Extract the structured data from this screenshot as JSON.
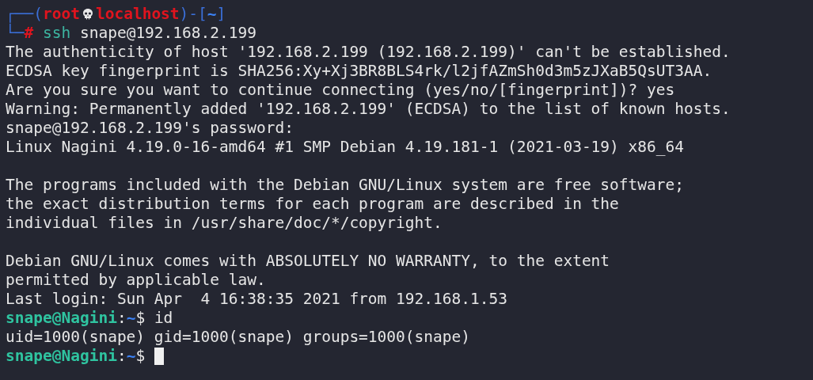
{
  "terminal": {
    "lines": [
      {
        "kind": "prompt",
        "segments": [
          {
            "kind": "frame",
            "text": "┌──("
          },
          {
            "kind": "user",
            "text": "root"
          },
          {
            "kind": "skull"
          },
          {
            "kind": "user",
            "text": "localhost"
          },
          {
            "kind": "frame",
            "text": ")-["
          },
          {
            "kind": "path",
            "text": "~"
          },
          {
            "kind": "frame",
            "text": "]"
          }
        ]
      },
      {
        "kind": "prompt",
        "segments": [
          {
            "kind": "frame",
            "text": "└─"
          },
          {
            "kind": "user",
            "text": "#"
          },
          {
            "kind": "command",
            "text": "ssh",
            "space_before": true
          },
          {
            "kind": "plain",
            "text": "snape@192.168.2.199",
            "space_before": true
          }
        ]
      },
      {
        "kind": "output",
        "text": "The authenticity of host '192.168.2.199 (192.168.2.199)' can't be established."
      },
      {
        "kind": "output",
        "text": "ECDSA key fingerprint is SHA256:Xy+Xj3BR8BLS4rk/l2jfAZmSh0d3m5zJXaB5QsUT3AA."
      },
      {
        "kind": "output",
        "text": "Are you sure you want to continue connecting (yes/no/[fingerprint])? yes"
      },
      {
        "kind": "output",
        "text": "Warning: Permanently added '192.168.2.199' (ECDSA) to the list of known hosts."
      },
      {
        "kind": "output",
        "text": "snape@192.168.2.199's password:"
      },
      {
        "kind": "output",
        "text": "Linux Nagini 4.19.0-16-amd64 #1 SMP Debian 4.19.181-1 (2021-03-19) x86_64"
      },
      {
        "kind": "blank"
      },
      {
        "kind": "output",
        "text": "The programs included with the Debian GNU/Linux system are free software;"
      },
      {
        "kind": "output",
        "text": "the exact distribution terms for each program are described in the"
      },
      {
        "kind": "output",
        "text": "individual files in /usr/share/doc/*/copyright."
      },
      {
        "kind": "blank"
      },
      {
        "kind": "output",
        "text": "Debian GNU/Linux comes with ABSOLUTELY NO WARRANTY, to the extent"
      },
      {
        "kind": "output",
        "text": "permitted by applicable law."
      },
      {
        "kind": "output",
        "text": "Last login: Sun Apr  4 16:38:35 2021 from 192.168.1.53"
      },
      {
        "kind": "prompt",
        "segments": [
          {
            "kind": "userhost",
            "text": "snape@Nagini"
          },
          {
            "kind": "plain",
            "text": ":"
          },
          {
            "kind": "path",
            "text": "~"
          },
          {
            "kind": "plain",
            "text": "$"
          },
          {
            "kind": "plain",
            "text": "id",
            "space_before": true
          }
        ]
      },
      {
        "kind": "output",
        "text": "uid=1000(snape) gid=1000(snape) groups=1000(snape)"
      },
      {
        "kind": "prompt",
        "segments": [
          {
            "kind": "userhost",
            "text": "snape@Nagini"
          },
          {
            "kind": "plain",
            "text": ":"
          },
          {
            "kind": "path",
            "text": "~"
          },
          {
            "kind": "plain",
            "text": "$"
          },
          {
            "kind": "cursor",
            "space_before": true
          }
        ]
      }
    ]
  }
}
